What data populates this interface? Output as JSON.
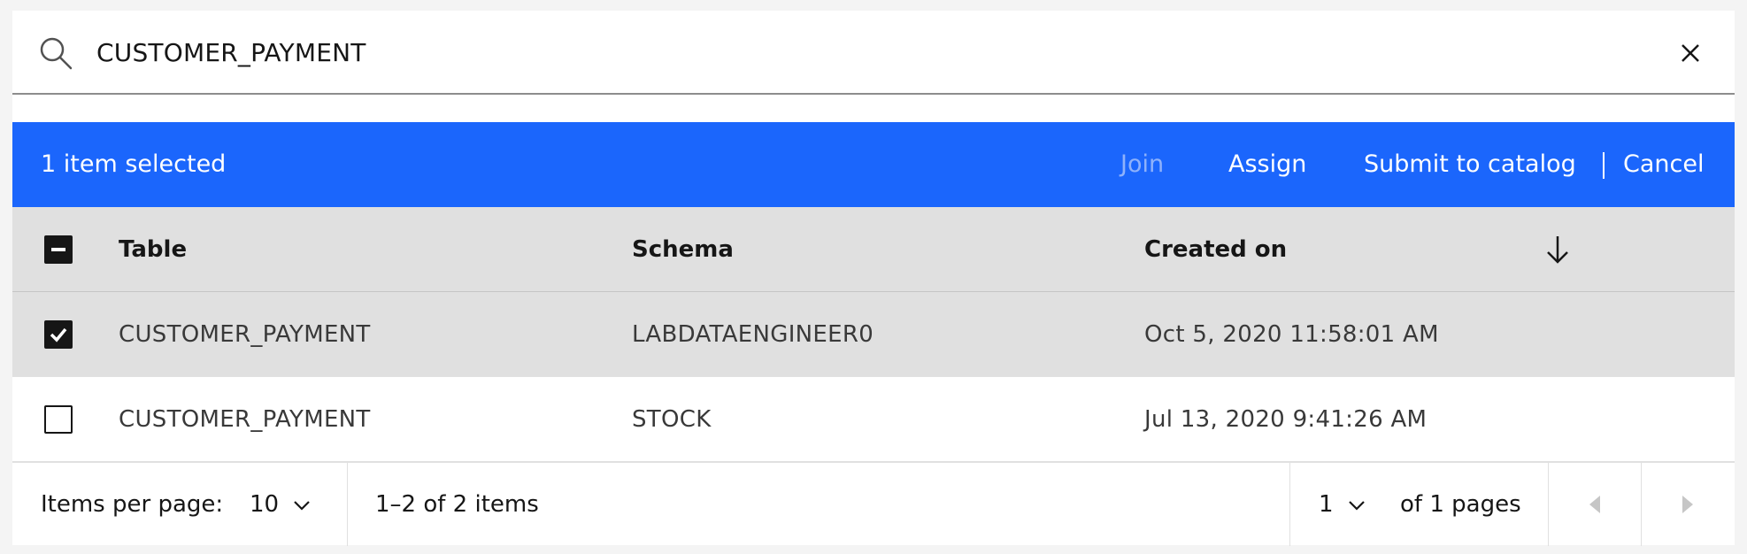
{
  "search": {
    "value": "CUSTOMER_PAYMENT",
    "icon": "search-icon",
    "clear_icon": "close-icon"
  },
  "action_bar": {
    "selected_text": "1 item selected",
    "join_label": "Join",
    "assign_label": "Assign",
    "submit_label": "Submit to catalog",
    "cancel_label": "Cancel",
    "color": "#1b66fc"
  },
  "table": {
    "headers": {
      "table": "Table",
      "schema": "Schema",
      "created": "Created on"
    },
    "rows": [
      {
        "table": "CUSTOMER_PAYMENT",
        "schema": "LABDATAENGINEER0",
        "created": "Oct 5, 2020 11:58:01 AM",
        "selected": true
      },
      {
        "table": "CUSTOMER_PAYMENT",
        "schema": "STOCK",
        "created": "Jul 13, 2020 9:41:26 AM",
        "selected": false
      }
    ]
  },
  "pagination": {
    "items_per_page_label": "Items per page:",
    "items_per_page_value": "10",
    "range_text": "1–2 of 2 items",
    "page_value": "1",
    "page_total_text": "of 1 pages"
  }
}
